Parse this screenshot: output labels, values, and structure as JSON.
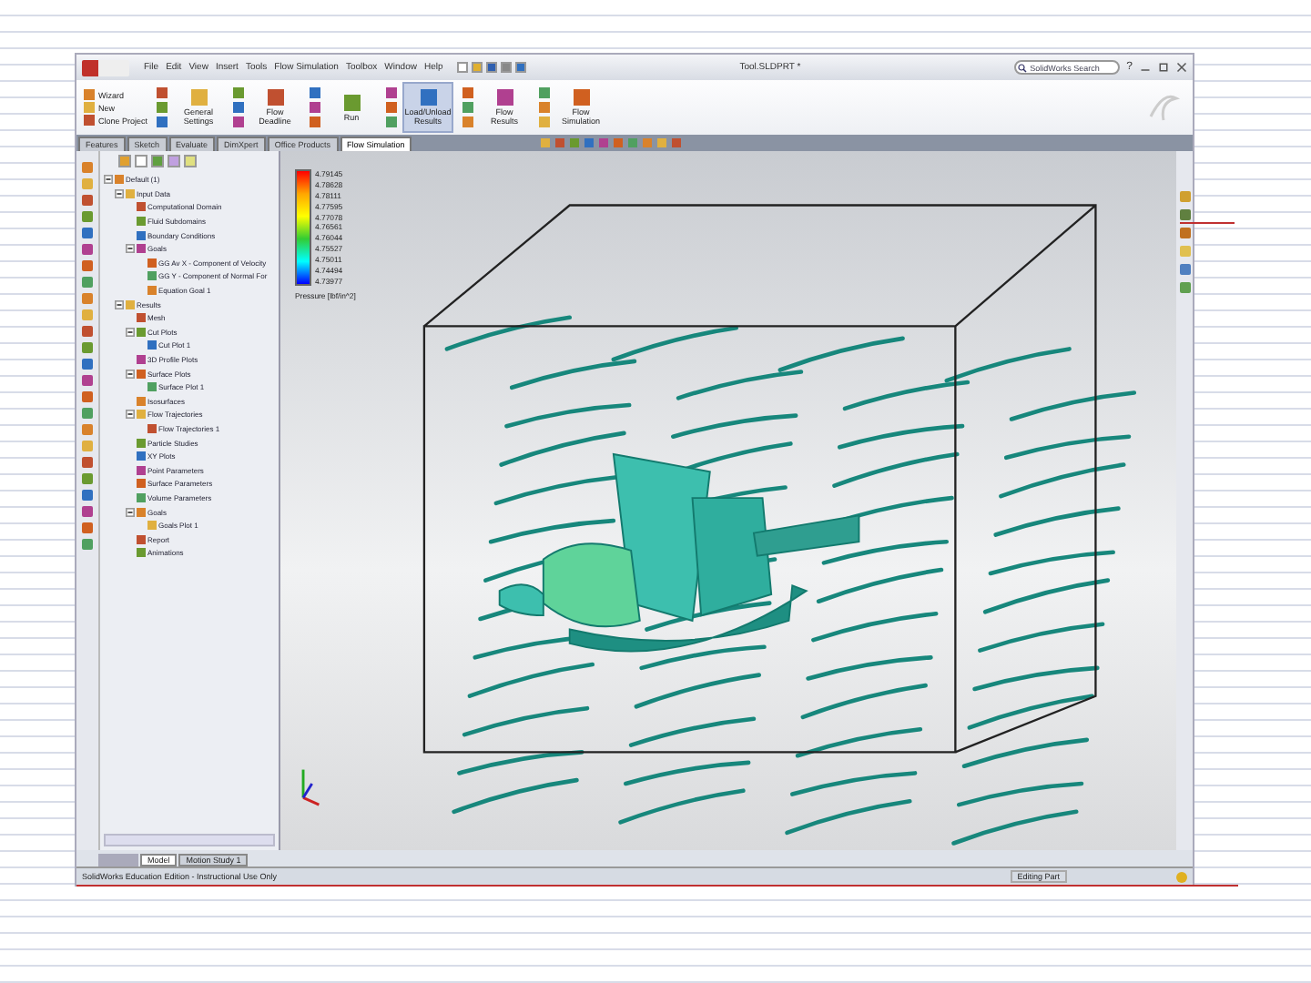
{
  "window": {
    "title": "Tool.SLDPRT *",
    "search": {
      "placeholder": "SolidWorks Search"
    },
    "help": "?"
  },
  "menu": [
    "File",
    "Edit",
    "View",
    "Insert",
    "Tools",
    "Flow Simulation",
    "Toolbox",
    "Window",
    "Help"
  ],
  "toolbar": [
    {
      "kind": "stack",
      "items": [
        "Wizard",
        "New",
        "Clone Project"
      ]
    },
    {
      "kind": "big",
      "label": "General Settings",
      "selected": false
    },
    {
      "kind": "big",
      "label": "Flow Deadline",
      "selected": false
    },
    {
      "kind": "big",
      "label": "Run",
      "selected": false
    },
    {
      "kind": "big",
      "label": "Load/Unload Results",
      "selected": true
    },
    {
      "kind": "big",
      "label": "Flow Results",
      "selected": false
    },
    {
      "kind": "big",
      "label": "Flow Simulation",
      "selected": false
    }
  ],
  "tabs": [
    {
      "label": "Features",
      "selected": false
    },
    {
      "label": "Sketch",
      "selected": false
    },
    {
      "label": "Evaluate",
      "selected": false
    },
    {
      "label": "DimXpert",
      "selected": false
    },
    {
      "label": "Office Products",
      "selected": false
    },
    {
      "label": "Flow Simulation",
      "selected": true
    }
  ],
  "tree": [
    {
      "label": "Default (1)",
      "expanded": true,
      "children": [
        {
          "label": "Input Data",
          "expanded": true,
          "children": [
            {
              "label": "Computational Domain"
            },
            {
              "label": "Fluid Subdomains"
            },
            {
              "label": "Boundary Conditions"
            },
            {
              "label": "Goals",
              "expanded": true,
              "children": [
                {
                  "label": "GG Av X - Component of Velocity"
                },
                {
                  "label": "GG Y - Component of Normal For"
                },
                {
                  "label": "Equation Goal 1"
                }
              ]
            }
          ]
        },
        {
          "label": "Results",
          "expanded": true,
          "children": [
            {
              "label": "Mesh"
            },
            {
              "label": "Cut Plots",
              "expanded": true,
              "children": [
                {
                  "label": "Cut Plot 1"
                }
              ]
            },
            {
              "label": "3D Profile Plots"
            },
            {
              "label": "Surface Plots",
              "expanded": true,
              "children": [
                {
                  "label": "Surface Plot 1"
                }
              ]
            },
            {
              "label": "Isosurfaces"
            },
            {
              "label": "Flow Trajectories",
              "expanded": true,
              "children": [
                {
                  "label": "Flow Trajectories 1"
                }
              ]
            },
            {
              "label": "Particle Studies"
            },
            {
              "label": "XY Plots"
            },
            {
              "label": "Point Parameters"
            },
            {
              "label": "Surface Parameters"
            },
            {
              "label": "Volume Parameters"
            },
            {
              "label": "Goals",
              "expanded": true,
              "children": [
                {
                  "label": "Goals Plot 1"
                }
              ]
            },
            {
              "label": "Report"
            },
            {
              "label": "Animations"
            }
          ]
        }
      ]
    }
  ],
  "legend": {
    "values": [
      "4.79145",
      "4.78628",
      "4.78111",
      "4.77595",
      "4.77078",
      "4.76561",
      "4.76044",
      "4.75527",
      "4.75011",
      "4.74494",
      "4.73977"
    ],
    "title": "Pressure [lbf/in^2]"
  },
  "bottom_tabs": [
    {
      "label": "Model",
      "selected": true
    },
    {
      "label": "Motion Study 1",
      "selected": false
    }
  ],
  "status_bar": {
    "left": "SolidWorks Education Edition - Instructional Use Only",
    "right": "Editing Part"
  }
}
